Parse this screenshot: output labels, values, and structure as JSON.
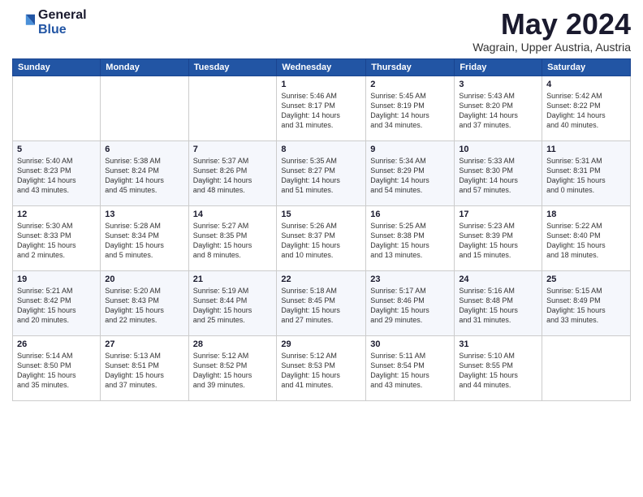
{
  "logo": {
    "general": "General",
    "blue": "Blue"
  },
  "title": "May 2024",
  "subtitle": "Wagrain, Upper Austria, Austria",
  "days_of_week": [
    "Sunday",
    "Monday",
    "Tuesday",
    "Wednesday",
    "Thursday",
    "Friday",
    "Saturday"
  ],
  "weeks": [
    [
      {
        "day": "",
        "info": ""
      },
      {
        "day": "",
        "info": ""
      },
      {
        "day": "",
        "info": ""
      },
      {
        "day": "1",
        "info": "Sunrise: 5:46 AM\nSunset: 8:17 PM\nDaylight: 14 hours\nand 31 minutes."
      },
      {
        "day": "2",
        "info": "Sunrise: 5:45 AM\nSunset: 8:19 PM\nDaylight: 14 hours\nand 34 minutes."
      },
      {
        "day": "3",
        "info": "Sunrise: 5:43 AM\nSunset: 8:20 PM\nDaylight: 14 hours\nand 37 minutes."
      },
      {
        "day": "4",
        "info": "Sunrise: 5:42 AM\nSunset: 8:22 PM\nDaylight: 14 hours\nand 40 minutes."
      }
    ],
    [
      {
        "day": "5",
        "info": "Sunrise: 5:40 AM\nSunset: 8:23 PM\nDaylight: 14 hours\nand 43 minutes."
      },
      {
        "day": "6",
        "info": "Sunrise: 5:38 AM\nSunset: 8:24 PM\nDaylight: 14 hours\nand 45 minutes."
      },
      {
        "day": "7",
        "info": "Sunrise: 5:37 AM\nSunset: 8:26 PM\nDaylight: 14 hours\nand 48 minutes."
      },
      {
        "day": "8",
        "info": "Sunrise: 5:35 AM\nSunset: 8:27 PM\nDaylight: 14 hours\nand 51 minutes."
      },
      {
        "day": "9",
        "info": "Sunrise: 5:34 AM\nSunset: 8:29 PM\nDaylight: 14 hours\nand 54 minutes."
      },
      {
        "day": "10",
        "info": "Sunrise: 5:33 AM\nSunset: 8:30 PM\nDaylight: 14 hours\nand 57 minutes."
      },
      {
        "day": "11",
        "info": "Sunrise: 5:31 AM\nSunset: 8:31 PM\nDaylight: 15 hours\nand 0 minutes."
      }
    ],
    [
      {
        "day": "12",
        "info": "Sunrise: 5:30 AM\nSunset: 8:33 PM\nDaylight: 15 hours\nand 2 minutes."
      },
      {
        "day": "13",
        "info": "Sunrise: 5:28 AM\nSunset: 8:34 PM\nDaylight: 15 hours\nand 5 minutes."
      },
      {
        "day": "14",
        "info": "Sunrise: 5:27 AM\nSunset: 8:35 PM\nDaylight: 15 hours\nand 8 minutes."
      },
      {
        "day": "15",
        "info": "Sunrise: 5:26 AM\nSunset: 8:37 PM\nDaylight: 15 hours\nand 10 minutes."
      },
      {
        "day": "16",
        "info": "Sunrise: 5:25 AM\nSunset: 8:38 PM\nDaylight: 15 hours\nand 13 minutes."
      },
      {
        "day": "17",
        "info": "Sunrise: 5:23 AM\nSunset: 8:39 PM\nDaylight: 15 hours\nand 15 minutes."
      },
      {
        "day": "18",
        "info": "Sunrise: 5:22 AM\nSunset: 8:40 PM\nDaylight: 15 hours\nand 18 minutes."
      }
    ],
    [
      {
        "day": "19",
        "info": "Sunrise: 5:21 AM\nSunset: 8:42 PM\nDaylight: 15 hours\nand 20 minutes."
      },
      {
        "day": "20",
        "info": "Sunrise: 5:20 AM\nSunset: 8:43 PM\nDaylight: 15 hours\nand 22 minutes."
      },
      {
        "day": "21",
        "info": "Sunrise: 5:19 AM\nSunset: 8:44 PM\nDaylight: 15 hours\nand 25 minutes."
      },
      {
        "day": "22",
        "info": "Sunrise: 5:18 AM\nSunset: 8:45 PM\nDaylight: 15 hours\nand 27 minutes."
      },
      {
        "day": "23",
        "info": "Sunrise: 5:17 AM\nSunset: 8:46 PM\nDaylight: 15 hours\nand 29 minutes."
      },
      {
        "day": "24",
        "info": "Sunrise: 5:16 AM\nSunset: 8:48 PM\nDaylight: 15 hours\nand 31 minutes."
      },
      {
        "day": "25",
        "info": "Sunrise: 5:15 AM\nSunset: 8:49 PM\nDaylight: 15 hours\nand 33 minutes."
      }
    ],
    [
      {
        "day": "26",
        "info": "Sunrise: 5:14 AM\nSunset: 8:50 PM\nDaylight: 15 hours\nand 35 minutes."
      },
      {
        "day": "27",
        "info": "Sunrise: 5:13 AM\nSunset: 8:51 PM\nDaylight: 15 hours\nand 37 minutes."
      },
      {
        "day": "28",
        "info": "Sunrise: 5:12 AM\nSunset: 8:52 PM\nDaylight: 15 hours\nand 39 minutes."
      },
      {
        "day": "29",
        "info": "Sunrise: 5:12 AM\nSunset: 8:53 PM\nDaylight: 15 hours\nand 41 minutes."
      },
      {
        "day": "30",
        "info": "Sunrise: 5:11 AM\nSunset: 8:54 PM\nDaylight: 15 hours\nand 43 minutes."
      },
      {
        "day": "31",
        "info": "Sunrise: 5:10 AM\nSunset: 8:55 PM\nDaylight: 15 hours\nand 44 minutes."
      },
      {
        "day": "",
        "info": ""
      }
    ]
  ]
}
